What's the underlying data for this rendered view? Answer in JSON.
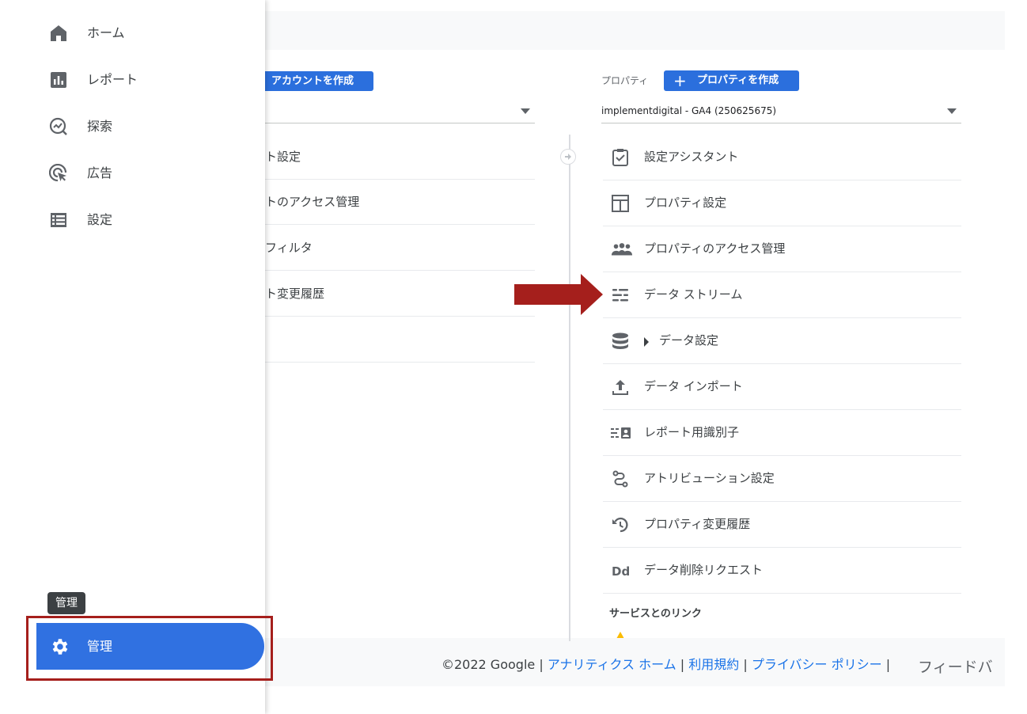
{
  "sidebar": {
    "nav": [
      {
        "label": "ホーム",
        "icon": "home-icon"
      },
      {
        "label": "レポート",
        "icon": "bar-chart-icon"
      },
      {
        "label": "探索",
        "icon": "explore-icon"
      },
      {
        "label": "広告",
        "icon": "ads-cursor-icon"
      },
      {
        "label": "設定",
        "icon": "list-icon"
      }
    ],
    "admin_tooltip": "管理",
    "admin_label": "管理"
  },
  "account": {
    "create_label": "アカウントを作成",
    "rows": [
      "ト設定",
      "トのアクセス管理",
      "フィルタ",
      "ト変更履歴",
      ""
    ]
  },
  "property": {
    "label": "プロパティ",
    "create_label": "プロパティを作成",
    "selected": "implementdigital - GA4 (250625675)",
    "rows": [
      {
        "label": "設定アシスタント",
        "icon": "checklist-icon"
      },
      {
        "label": "プロパティ設定",
        "icon": "layout-icon"
      },
      {
        "label": "プロパティのアクセス管理",
        "icon": "people-icon"
      },
      {
        "label": "データ ストリーム",
        "icon": "streams-icon"
      },
      {
        "label": "データ設定",
        "icon": "database-icon"
      },
      {
        "label": "データ インポート",
        "icon": "upload-icon"
      },
      {
        "label": "レポート用識別子",
        "icon": "identity-icon"
      },
      {
        "label": "アトリビューション設定",
        "icon": "attribution-icon"
      },
      {
        "label": "プロパティ変更履歴",
        "icon": "history-icon"
      },
      {
        "label": "データ削除リクエスト",
        "icon": "data-deletion-icon"
      }
    ],
    "section_title": "サービスとのリンク"
  },
  "footer": {
    "copyright": "©2022 Google",
    "links": [
      "アナリティクス ホーム",
      "利用規約",
      "プライバシー ポリシー"
    ],
    "feedback": "フィードバ"
  },
  "colors": {
    "accent": "#3071e1",
    "annotation": "#a51f1c"
  }
}
